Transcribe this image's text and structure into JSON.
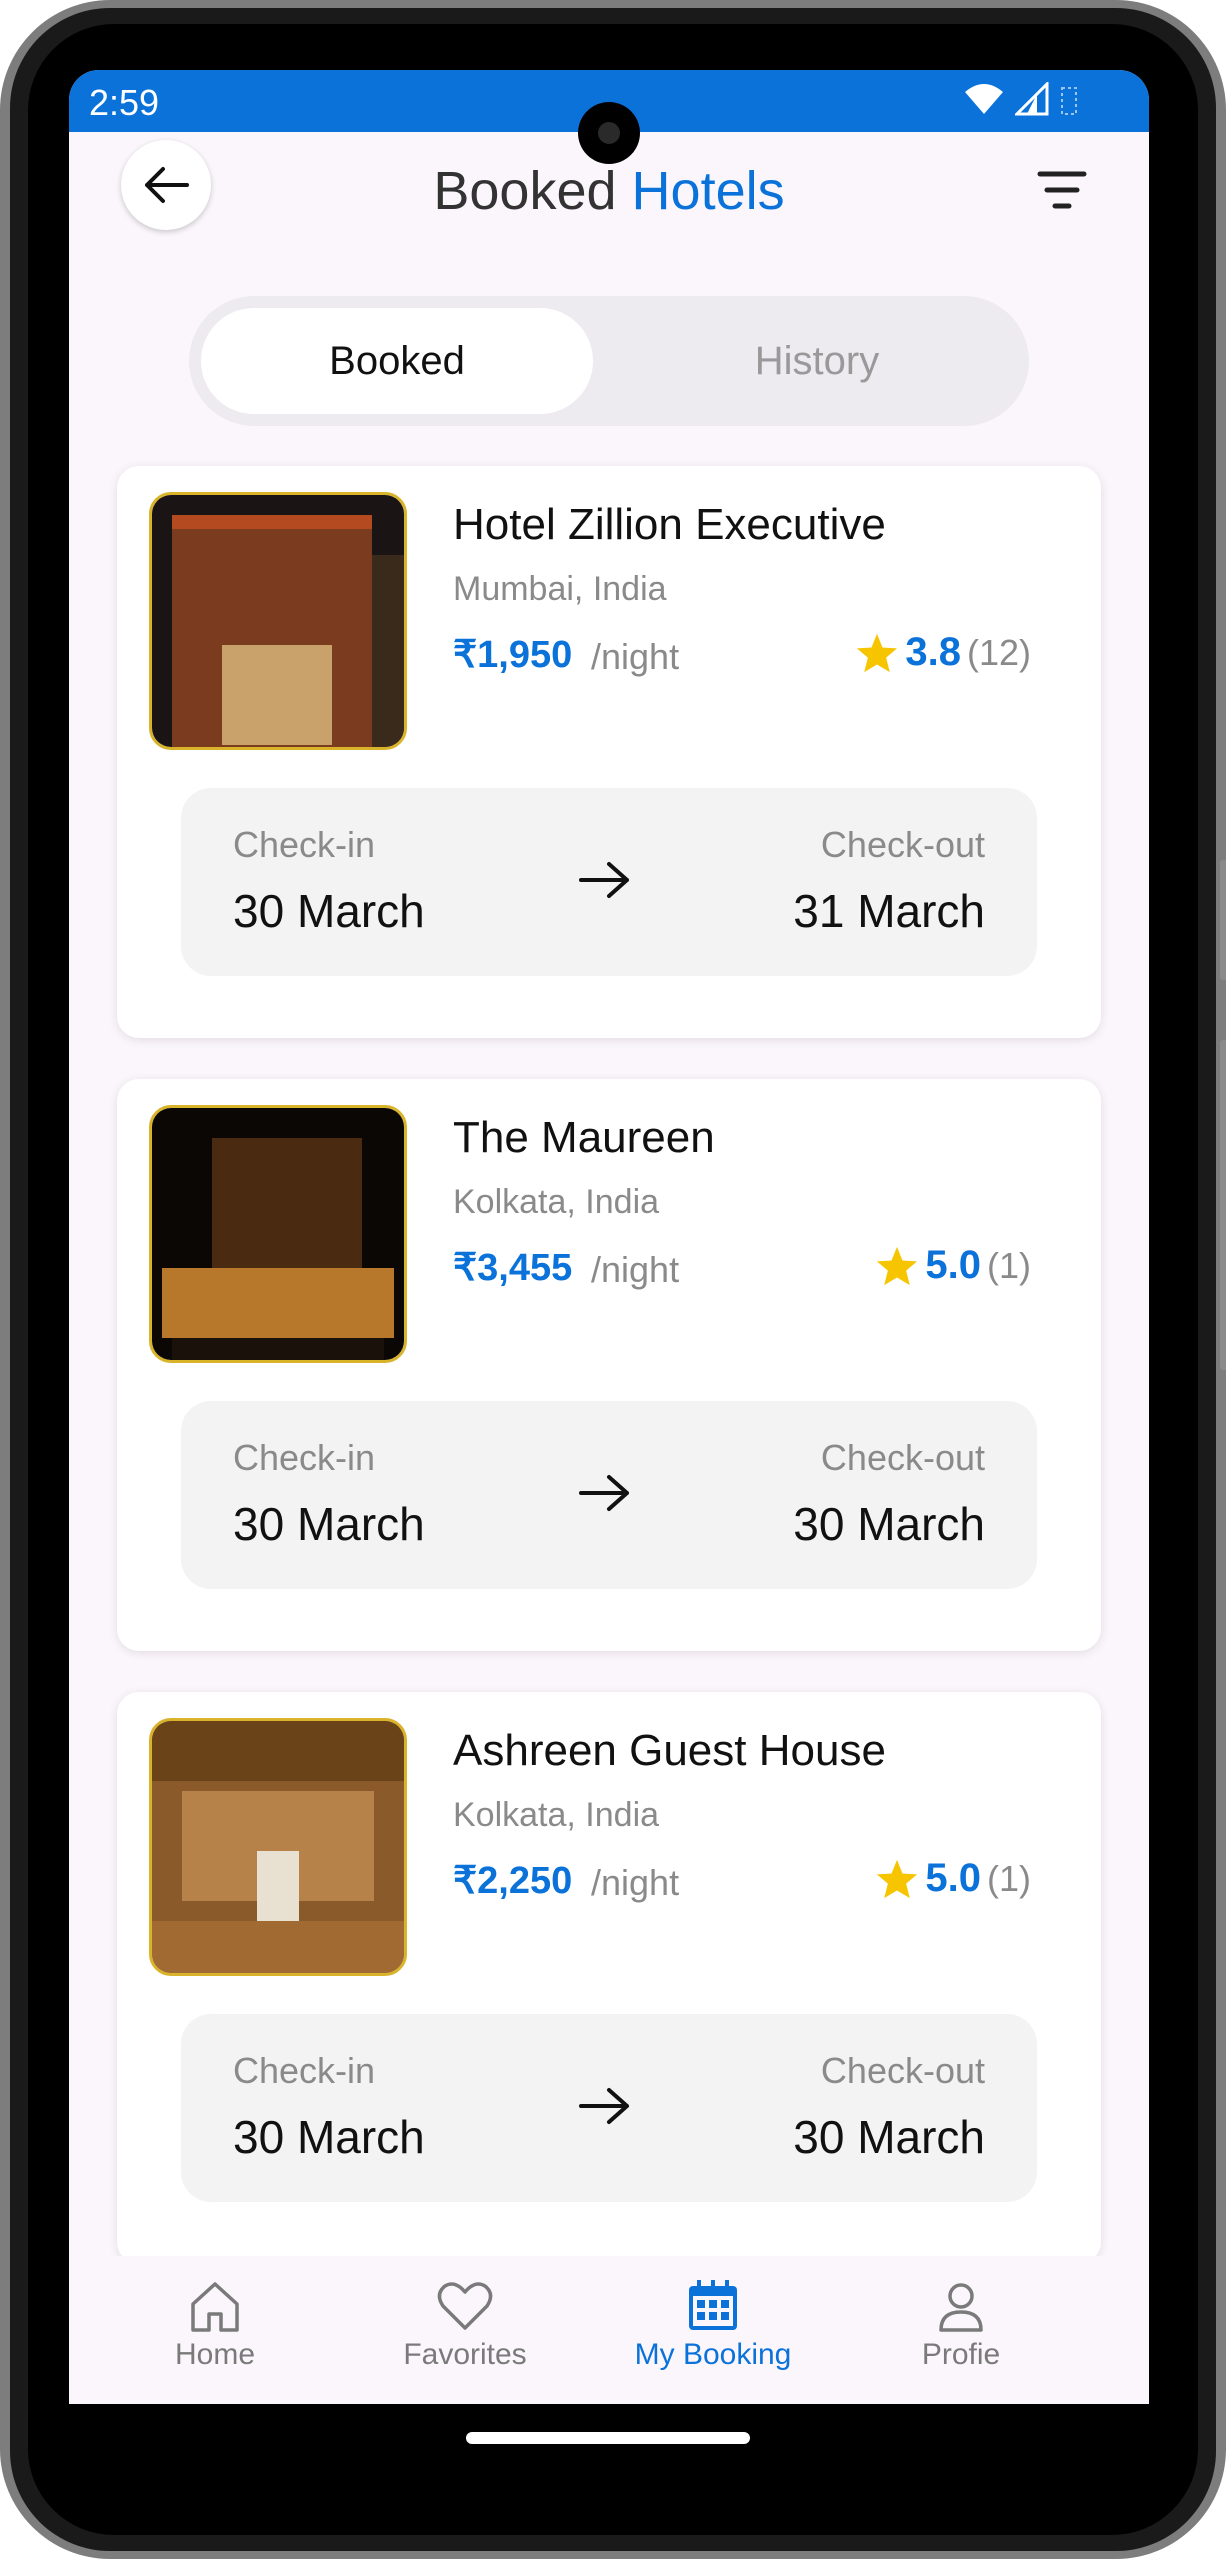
{
  "status": {
    "time": "2:59"
  },
  "header": {
    "title_main": "Booked",
    "title_accent": "Hotels"
  },
  "tabs": [
    {
      "label": "Booked"
    },
    {
      "label": "History"
    }
  ],
  "bookings": [
    {
      "name": "Hotel Zillion Executive",
      "location": "Mumbai, India",
      "price": "₹1,950",
      "unit": "/night",
      "rating": "3.8",
      "reviews": "(12)",
      "checkin_label": "Check-in",
      "checkin": "30 March",
      "checkout_label": "Check-out",
      "checkout": "31 March"
    },
    {
      "name": "The Maureen",
      "location": "Kolkata, India",
      "price": "₹3,455",
      "unit": "/night",
      "rating": "5.0",
      "reviews": "(1)",
      "checkin_label": "Check-in",
      "checkin": "30 March",
      "checkout_label": "Check-out",
      "checkout": "30 March"
    },
    {
      "name": "Ashreen Guest House",
      "location": "Kolkata, India",
      "price": "₹2,250",
      "unit": "/night",
      "rating": "5.0",
      "reviews": "(1)",
      "checkin_label": "Check-in",
      "checkin": "30 March",
      "checkout_label": "Check-out",
      "checkout": "30 March"
    }
  ],
  "nav": [
    {
      "label": "Home",
      "icon": "home-icon"
    },
    {
      "label": "Favorites",
      "icon": "heart-icon"
    },
    {
      "label": "My Booking",
      "icon": "calendar-icon"
    },
    {
      "label": "Profie",
      "icon": "user-icon"
    }
  ],
  "colors": {
    "accent": "#0a72d9",
    "star": "#f7c400",
    "background": "#fbf6fb"
  }
}
